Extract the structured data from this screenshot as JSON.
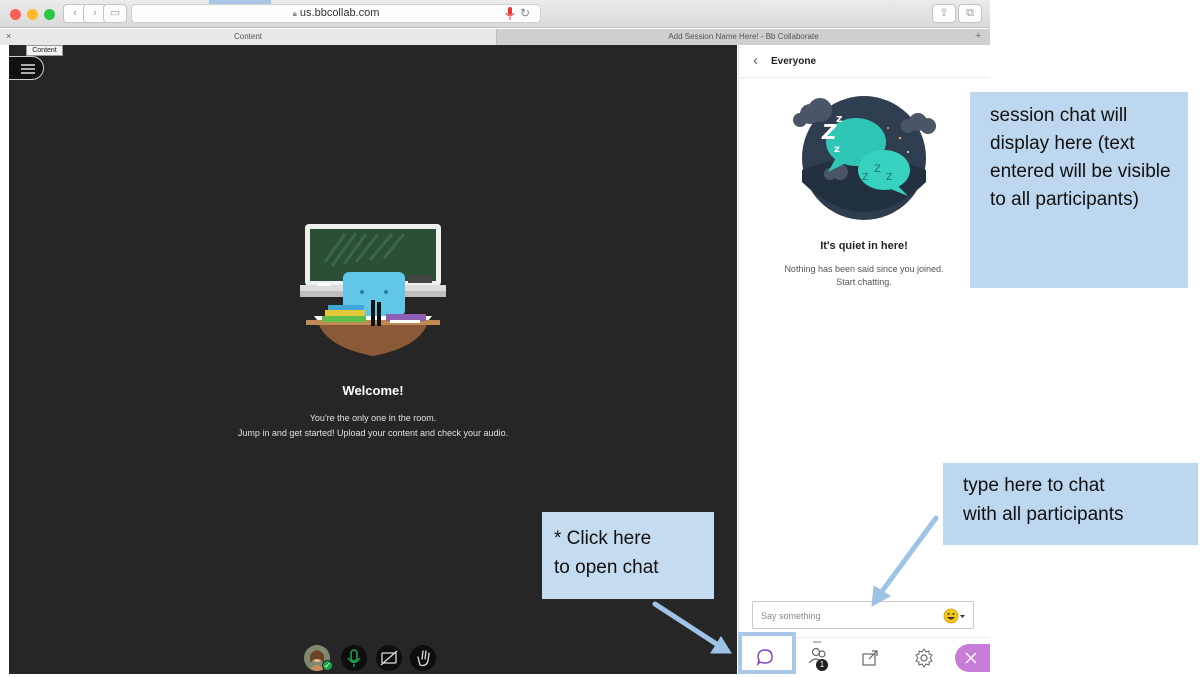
{
  "browser": {
    "url": "us.bbcollab.com",
    "tabs": [
      {
        "label": "Content"
      },
      {
        "label": "Add Session Name Here! - Bb Collaborate"
      }
    ],
    "close_tab_glyph": "×",
    "new_tab_glyph": "+"
  },
  "stage": {
    "tooltip": "Content",
    "welcome_title": "Welcome!",
    "welcome_line1": "You're the only one in the room.",
    "welcome_line2": "Jump in and get started! Upload your content and check your audio."
  },
  "chat": {
    "header": "Everyone",
    "back_glyph": "‹",
    "quiet_title": "It's quiet in here!",
    "quiet_line1": "Nothing has been said since you joined.",
    "quiet_line2": "Start chatting.",
    "input_placeholder": "Say something",
    "participant_count": "1"
  },
  "annotations": {
    "session_chat": "session chat will display here (text entered will be visible to all participants)",
    "type_here_l1": "type here to chat",
    "type_here_l2": "with all participants",
    "click_here_l1": "* Click here",
    "click_here_l2": "to open chat"
  },
  "colors": {
    "stage_bg": "#262626",
    "annotation_bg": "#bdd7ee",
    "annotation_arrow": "#9dc3e6",
    "chat_accent": "#7b3fbf",
    "close_button": "#c77dd8",
    "mic_active": "#1fa34a"
  },
  "icons": [
    "menu-icon",
    "mic-icon",
    "camera-off-icon",
    "raise-hand-icon",
    "chat-icon",
    "attendees-icon",
    "share-icon",
    "settings-icon",
    "close-icon",
    "emoji-icon"
  ]
}
